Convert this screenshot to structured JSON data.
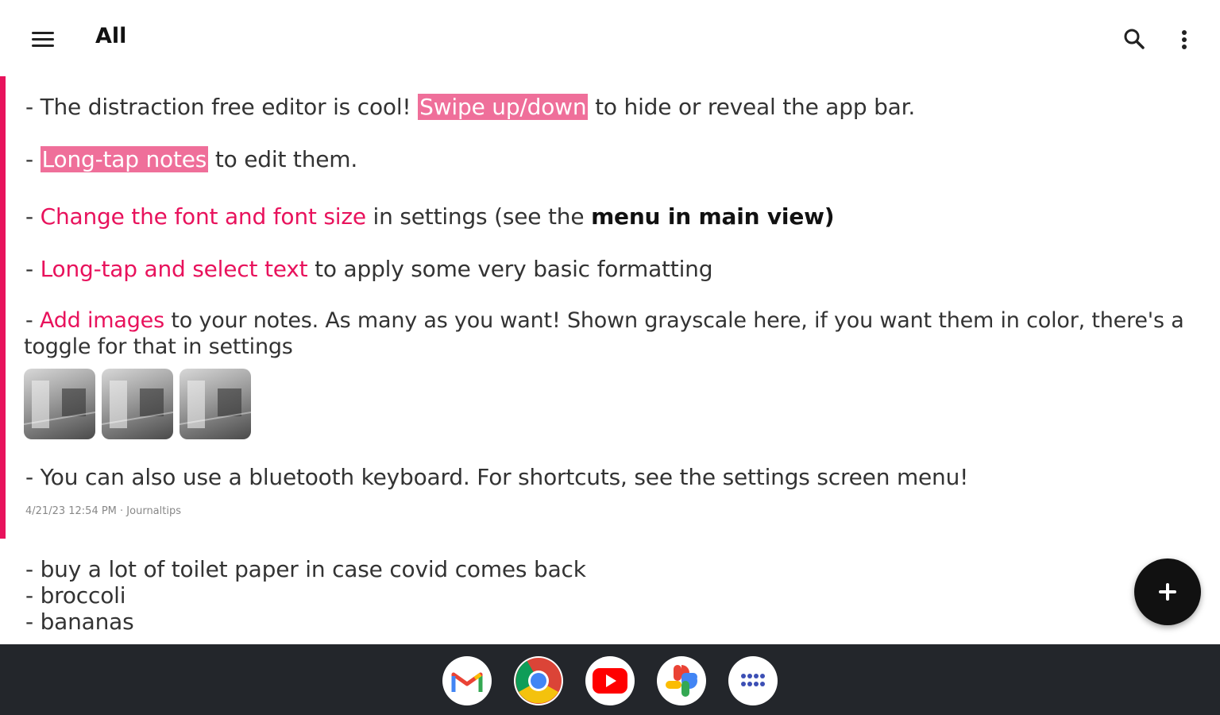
{
  "appbar": {
    "title": "All",
    "menu_icon": "hamburger-menu-icon",
    "search_icon": "search-icon",
    "more_icon": "more-vert-icon"
  },
  "note1": {
    "accent_color": "#e8125c",
    "line1": {
      "prefix": "- The distraction free editor is cool! ",
      "highlight": "Swipe up/down",
      "suffix": " to hide or reveal the app bar."
    },
    "line2": {
      "prefix": "- ",
      "highlight": "Long-tap notes",
      "suffix": " to edit them."
    },
    "line3": {
      "prefix": "- ",
      "colored": "Change the font and font size",
      "mid": " in settings (see the ",
      "bold": "menu in main view)"
    },
    "line4": {
      "prefix": "- ",
      "colored": "Long-tap and select text",
      "suffix": " to apply some very basic formatting"
    },
    "line5": {
      "prefix": "- ",
      "colored": "Add images",
      "suffix": " to your notes. As many as you want! Shown grayscale here, if you want them in color, there's a"
    },
    "line5b": "toggle for that in settings",
    "images": [
      "image-1",
      "image-2",
      "image-3"
    ],
    "line6": "- You can also use a bluetooth keyboard. For shortcuts, see the settings screen menu!",
    "meta": "4/21/23 12:54 PM · Journaltips"
  },
  "note2": {
    "lines": [
      "- buy a lot of toilet paper in case covid comes back",
      "- broccoli",
      "- bananas"
    ]
  },
  "fab": {
    "icon": "plus-icon"
  },
  "dock": {
    "apps": [
      "gmail-icon",
      "chrome-icon",
      "youtube-icon",
      "photos-icon",
      "app-launcher-icon"
    ]
  }
}
